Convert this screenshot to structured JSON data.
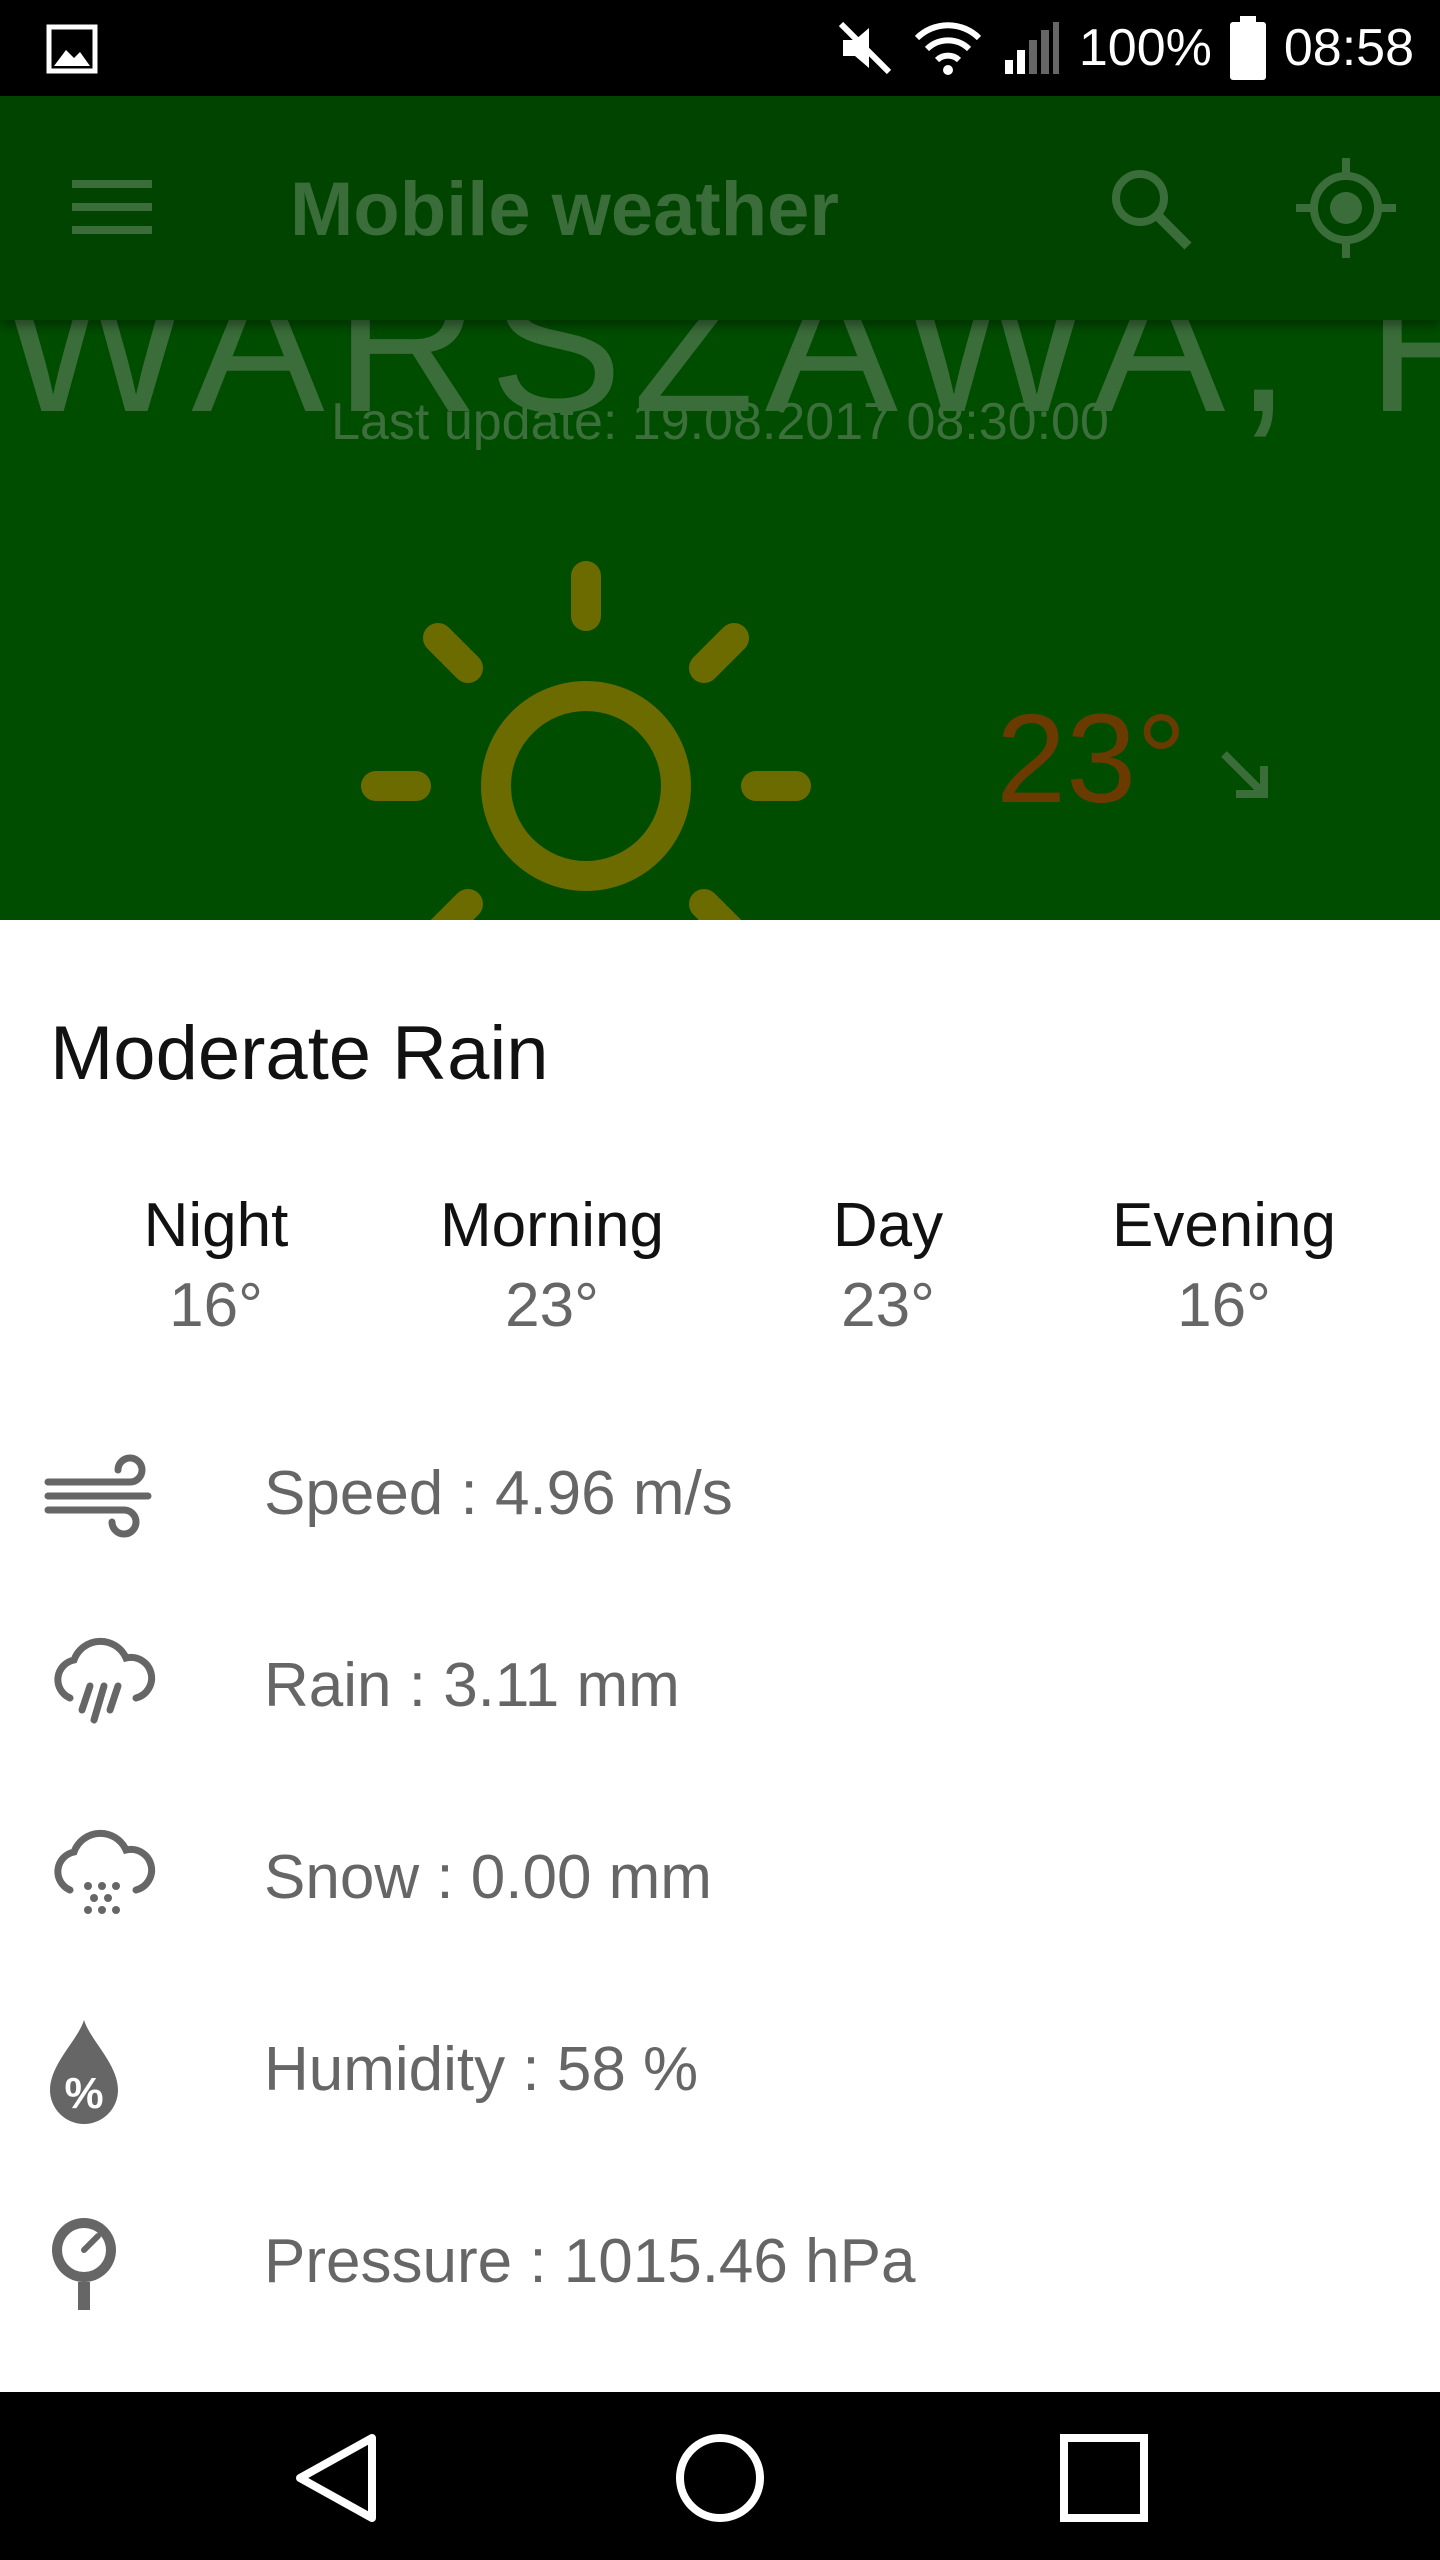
{
  "status_bar": {
    "battery": "100%",
    "time": "08:58",
    "icons": [
      "gallery-icon",
      "mute-icon",
      "wifi-icon",
      "signal-icon",
      "battery-icon"
    ]
  },
  "app": {
    "title": "Mobile weather",
    "city": "WARSZAWA, PL",
    "last_update": "Last update: 19.08.2017 08:30:00",
    "temperature": "23°",
    "icons": [
      "menu-icon",
      "search-icon",
      "locate-icon",
      "sun-icon",
      "trend-down-icon"
    ],
    "colors": {
      "background": "#004d00",
      "toolbar": "#004400",
      "sun": "#6b6b00",
      "temperature": "#6b3a00"
    }
  },
  "sheet": {
    "title": "Moderate Rain",
    "day_parts": [
      {
        "label": "Night",
        "temp": "16°"
      },
      {
        "label": "Morning",
        "temp": "23°"
      },
      {
        "label": "Day",
        "temp": "23°"
      },
      {
        "label": "Evening",
        "temp": "16°"
      }
    ],
    "details": [
      {
        "icon": "wind-icon",
        "text": "Speed : 4.96 m/s"
      },
      {
        "icon": "rain-icon",
        "text": "Rain : 3.11 mm"
      },
      {
        "icon": "snow-icon",
        "text": "Snow : 0.00 mm"
      },
      {
        "icon": "humidity-icon",
        "text": "Humidity : 58 %"
      },
      {
        "icon": "pressure-icon",
        "text": "Pressure : 1015.46 hPa"
      }
    ]
  },
  "nav_bar": {
    "icons": [
      "back-icon",
      "home-icon",
      "recent-apps-icon"
    ]
  }
}
